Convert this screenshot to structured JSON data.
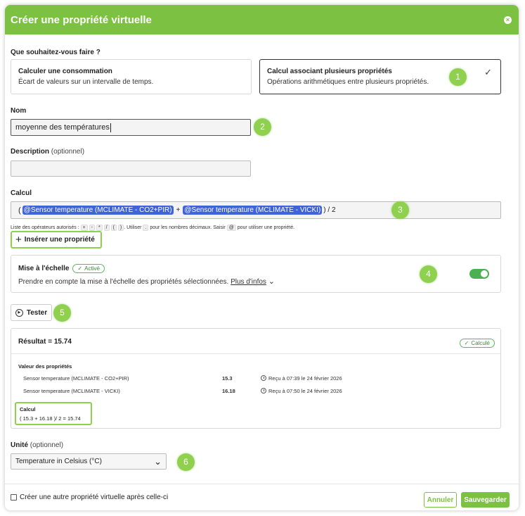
{
  "header": {
    "title": "Créer une propriété virtuelle",
    "close": "×"
  },
  "question": "Que souhaitez-vous faire ?",
  "options": [
    {
      "title": "Calculer une consommation",
      "subtitle": "Écart de valeurs sur un intervalle de temps."
    },
    {
      "title": "Calcul associant plusieurs propriétés",
      "subtitle": "Opérations arithmétiques entre plusieurs propriétés.",
      "check": "✓"
    }
  ],
  "steps": [
    "1",
    "2",
    "3",
    "4",
    "5",
    "6"
  ],
  "name": {
    "label": "Nom",
    "value": "moyenne des températures"
  },
  "description": {
    "label": "Description",
    "optional": "(optionnel)",
    "value": ""
  },
  "calcul": {
    "label": "Calcul",
    "open_paren": "(",
    "chip1": "@Sensor temperature (MCLIMATE - CO2+PIR)",
    "plus": "+",
    "chip2": "@Sensor temperature (MCLIMATE - VICKI)",
    "tail": ") / 2",
    "hint_start": "Liste des opérateurs autorisés :",
    "operators": [
      "+",
      "-",
      "*",
      "/",
      "(",
      ")"
    ],
    "hint_mid": ". Utiliser",
    "dot": ".",
    "hint_mid2": "pour les nombres décimaux. Saisir",
    "at": "@",
    "hint_end": "pour utiliser une propriété.",
    "insert_label": "Insérer une propriété",
    "insert_icon": "+"
  },
  "scaling": {
    "title": "Mise à l'échelle",
    "badge": "Activé",
    "badge_icon": "✓",
    "description": "Prendre en compte la mise à l'échelle des propriétés sélectionnées.",
    "more": "Plus d'infos",
    "chevron": "⌄",
    "enabled": true
  },
  "test": {
    "label": "Tester",
    "icon": "▶"
  },
  "result": {
    "title": "Résultat = 15.74",
    "badge": "Calculé",
    "badge_icon": "✓",
    "values_title": "Valeur des propriétés",
    "rows": [
      {
        "name": "Sensor temperature (MCLIMATE - CO2+PIR)",
        "value": "15.3",
        "received": "Reçu à 07:39 le 24 février 2026"
      },
      {
        "name": "Sensor temperature (MCLIMATE - VICKI)",
        "value": "16.18",
        "received": "Reçu à 07:50 le 24 février 2026"
      }
    ],
    "calc_title": "Calcul",
    "calc_value": "( 15.3 + 16.18 )/ 2 = 15.74"
  },
  "unit": {
    "label": "Unité",
    "optional": "(optionnel)",
    "value": "Temperature in Celsius (°C)",
    "chevron": "⌄"
  },
  "footer": {
    "checkbox_label": "Créer une autre propriété virtuelle après celle-ci",
    "cancel": "Annuler",
    "save": "Sauvegarder"
  },
  "colors": {
    "accent": "#7dc142",
    "chip": "#3f63d8",
    "toggle": "#4caf50"
  }
}
